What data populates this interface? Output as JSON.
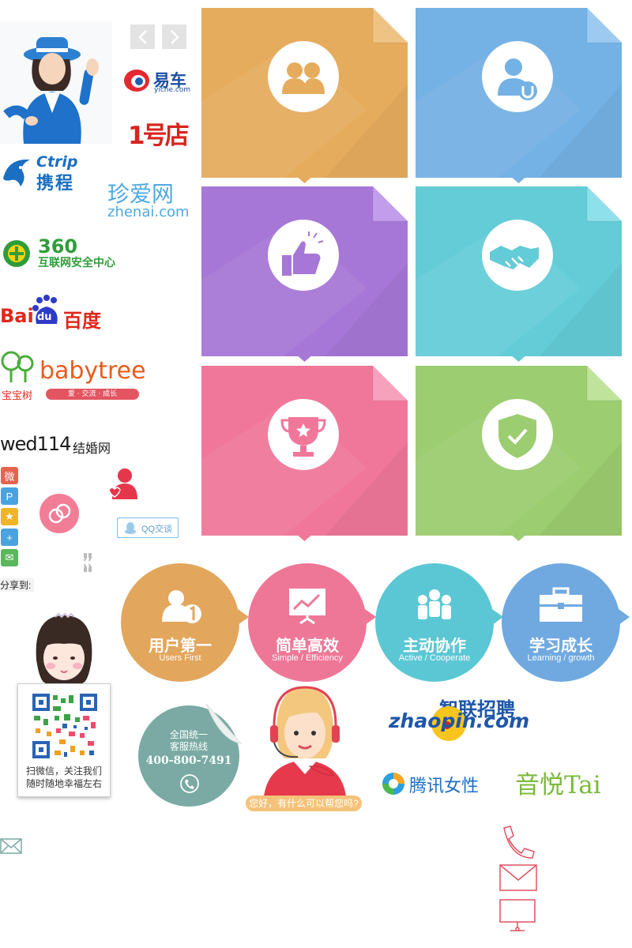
{
  "logos": {
    "yiche_cn": "易车",
    "yiche_en": "yiche.com",
    "yhd": "1号店",
    "ctrip_en": "Ctrip",
    "ctrip_cn": "携程",
    "zhenai_cn": "珍爱网",
    "zhenai_en": "zhenai.com",
    "s360_num": "360",
    "s360_cn": "互联网安全中心",
    "baidu_en1": "Bai",
    "baidu_en2": "du",
    "baidu_cn": "百度",
    "babytree_en": "babytree",
    "babytree_cn": "宝宝树",
    "babytree_tag": "爱 · 交流 · 成长",
    "wed_en": "wed114",
    "wed_cn": "结婚网",
    "zhaopin_cn": "智联招聘",
    "zhaopin_en": "zhaopin.com",
    "tencent_cn": "腾讯女性",
    "yinyue_cn": "音悦Tai"
  },
  "qq_chat_label": "QQ交谈",
  "share_label": "分享到:",
  "share_buttons": [
    {
      "name": "weibo",
      "color": "#e5634f",
      "glyph": "微"
    },
    {
      "name": "pinterest",
      "color": "#4aa3df",
      "glyph": "P"
    },
    {
      "name": "favorite",
      "color": "#f0b429",
      "glyph": "★"
    },
    {
      "name": "more",
      "color": "#4aa3df",
      "glyph": "+"
    },
    {
      "name": "wechat",
      "color": "#5bb75b",
      "glyph": "✉"
    }
  ],
  "tiles": [
    {
      "icon": "users-icon",
      "color": "#e5ac5d",
      "fold": "#efc384"
    },
    {
      "icon": "user-power-icon",
      "color": "#74b1e4",
      "fold": "#9ccaf0"
    },
    {
      "icon": "thumbs-up-icon",
      "color": "#a677d6",
      "fold": "#c29deb"
    },
    {
      "icon": "handshake-icon",
      "color": "#63ccd7",
      "fold": "#8ee0ea"
    },
    {
      "icon": "trophy-icon",
      "color": "#f0779a",
      "fold": "#f7a2bd"
    },
    {
      "icon": "shield-check-icon",
      "color": "#9ccd70",
      "fold": "#bfe39b"
    }
  ],
  "values": [
    {
      "zh": "用户第一",
      "en": "Users First",
      "color": "#e3a65d",
      "icon": "user-number-one-icon"
    },
    {
      "zh": "简单高效",
      "en": "Simple / Efficiency",
      "color": "#ee7797",
      "icon": "chart-board-icon"
    },
    {
      "zh": "主动协作",
      "en": "Active / Cooperate",
      "color": "#5cc7d4",
      "icon": "team-icon"
    },
    {
      "zh": "学习成长",
      "en": "Learning / growth",
      "color": "#6fa9e0",
      "icon": "briefcase-icon"
    }
  ],
  "qr_caption_1": "扫微信，关注我们",
  "qr_caption_2": "随时随地幸福左右",
  "hotline_title_1": "全国统一",
  "hotline_title_2": "客服热线",
  "hotline_number": "400-800-7491",
  "service_bubble": "您好，有什么可以帮您吗?"
}
